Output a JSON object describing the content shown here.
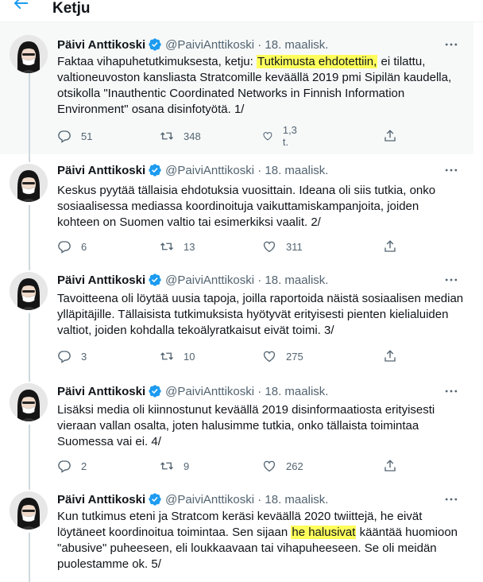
{
  "header": {
    "title": "Ketju"
  },
  "tweets": [
    {
      "name": "Päivi Anttikoski",
      "handle": "@PaiviAnttikoski · 18. maalisk.",
      "body_pre": "Faktaa vihapuhetutkimuksesta, ketju: ",
      "body_hl": "Tutkimusta ehdotettiin,",
      "body_post": " ei tilattu, valtioneuvoston kansliasta Stratcomille keväällä 2019 pmi Sipilän kaudella, otsikolla \"Inauthentic Coordinated Networks in Finnish Information Environment\" osana disinfotyötä. 1/",
      "replies": "51",
      "retweets": "348",
      "likes": "1,3 t."
    },
    {
      "name": "Päivi Anttikoski",
      "handle": "@PaiviAnttikoski · 18. maalisk.",
      "body": "Keskus pyytää tällaisia ehdotuksia vuosittain. Ideana oli siis tutkia, onko sosiaalisessa mediassa koordinoituja vaikuttamiskampanjoita, joiden kohteen on Suomen valtio tai esimerkiksi vaalit. 2/",
      "replies": "6",
      "retweets": "13",
      "likes": "311"
    },
    {
      "name": "Päivi Anttikoski",
      "handle": "@PaiviAnttikoski · 18. maalisk.",
      "body": "Tavoitteena oli löytää uusia tapoja, joilla raportoida näistä sosiaalisen median ylläpitäjille. Tällaisista tutkimuksista hyötyvät erityisesti pienten kielialuiden valtiot, joiden kohdalla tekoälyratkaisut eivät toimi. 3/",
      "replies": "3",
      "retweets": "10",
      "likes": "275"
    },
    {
      "name": "Päivi Anttikoski",
      "handle": "@PaiviAnttikoski · 18. maalisk.",
      "body": "Lisäksi media oli kiinnostunut keväällä 2019 disinformaatiosta erityisesti vieraan vallan osalta, joten halusimme tutkia, onko tällaista toimintaa Suomessa vai ei.  4/",
      "replies": "2",
      "retweets": "9",
      "likes": "262"
    },
    {
      "name": "Päivi Anttikoski",
      "handle": "@PaiviAnttikoski · 18. maalisk.",
      "body_pre": "Kun tutkimus eteni ja Stratcom keräsi keväällä 2020 twiittejä, he eivät löytäneet koordinoitua toimintaa. Sen sijaan ",
      "body_hl": "he halusivat",
      "body_post": " kääntää huomioon \"abusive\" puheeseen, eli  loukkaavaan tai vihapuheeseen. Se oli meidän puolestamme ok. 5/"
    }
  ],
  "colors": {
    "accent": "#1d9bf0",
    "highlight": "#ffff5c",
    "muted": "#536471"
  },
  "icons": [
    "back-arrow-icon",
    "verified-badge-icon",
    "more-icon",
    "reply-icon",
    "retweet-icon",
    "like-icon",
    "share-icon"
  ]
}
